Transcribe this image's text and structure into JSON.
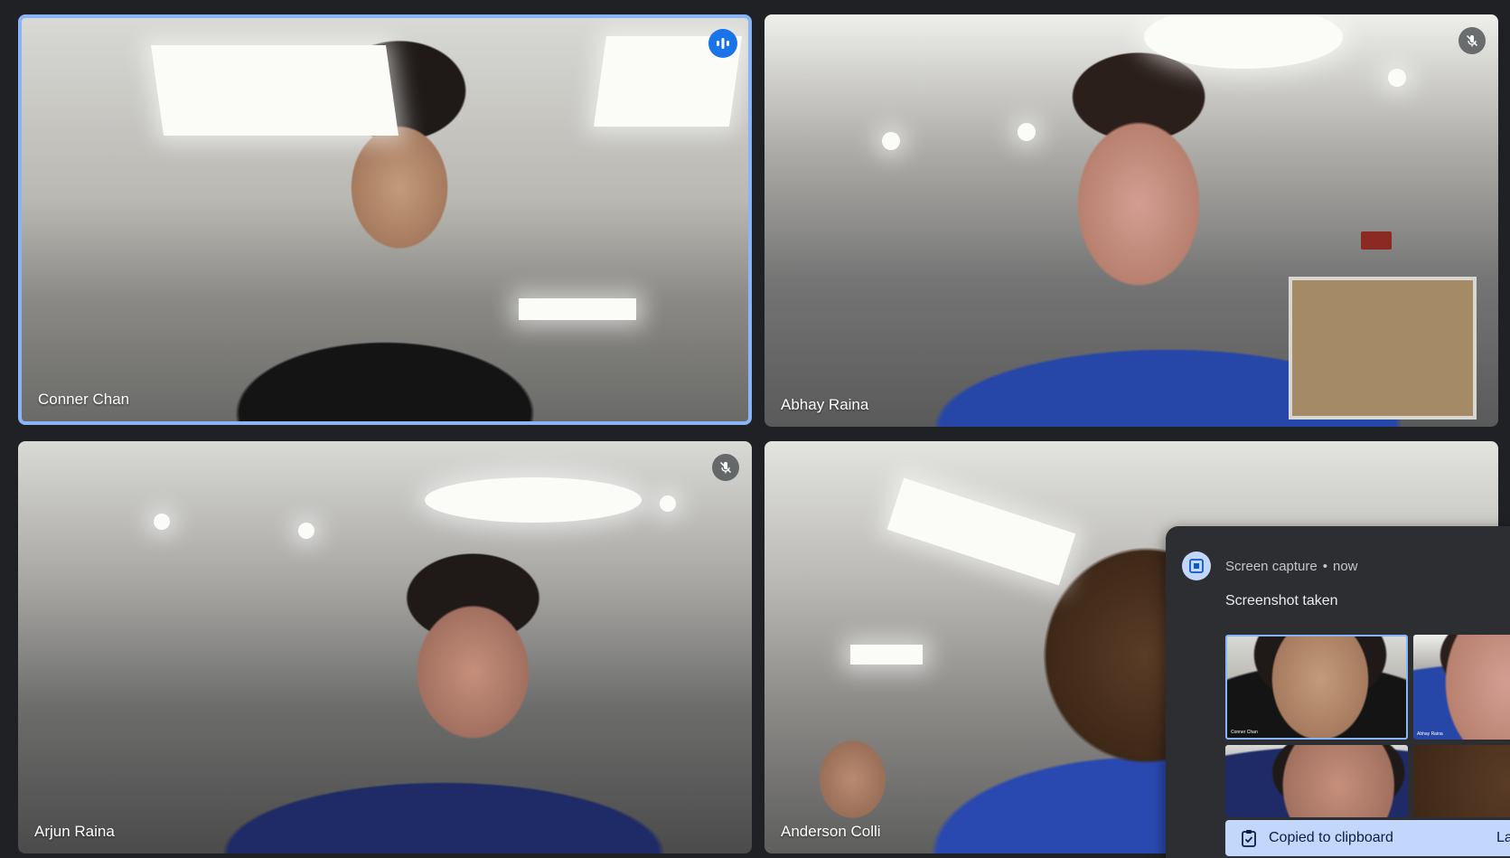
{
  "participants": [
    {
      "name": "Conner Chan",
      "status": "speaking"
    },
    {
      "name": "Abhay Raina",
      "status": "muted"
    },
    {
      "name": "Arjun Raina",
      "status": "muted"
    },
    {
      "name": "Anderson Colli",
      "status": "none"
    }
  ],
  "notification": {
    "app": "Screen capture",
    "separator": "•",
    "time": "now",
    "title": "Screenshot taken",
    "thumbnail_names": [
      "Conner Chan",
      "Abhay Raina"
    ],
    "clipboard_label": "Copied to clipboard",
    "clipboard_action": "La",
    "icon": "screen-capture-icon"
  },
  "colors": {
    "background": "#202124",
    "speaking_border": "#8ab4f8",
    "speaking_badge": "#1a73e8",
    "notification_bg": "#2d2e31",
    "clipboard_bar": "#c2d7fb"
  }
}
